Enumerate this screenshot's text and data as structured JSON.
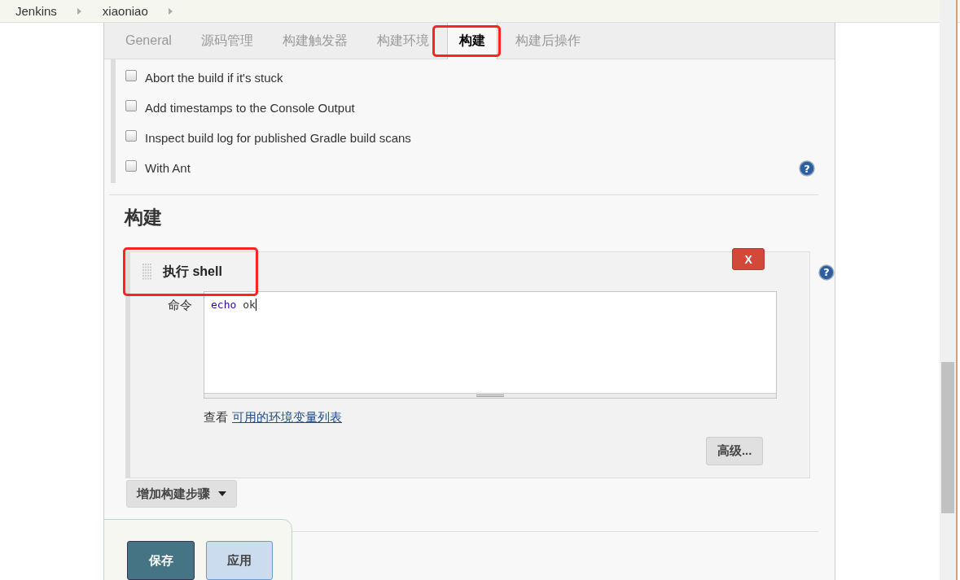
{
  "breadcrumbs": [
    {
      "label": "Jenkins"
    },
    {
      "label": "xiaoniao"
    }
  ],
  "tabs": [
    {
      "label": "General",
      "selected": false,
      "highlighted": false
    },
    {
      "label": "源码管理",
      "selected": false,
      "highlighted": false
    },
    {
      "label": "构建触发器",
      "selected": false,
      "highlighted": false
    },
    {
      "label": "构建环境",
      "selected": false,
      "highlighted": false
    },
    {
      "label": "构建",
      "selected": true,
      "highlighted": true
    },
    {
      "label": "构建后操作",
      "selected": false,
      "highlighted": false
    }
  ],
  "build_environment_options": [
    {
      "label": "Abort the build if it's stuck",
      "checked": false
    },
    {
      "label": "Add timestamps to the Console Output",
      "checked": false
    },
    {
      "label": "Inspect build log for published Gradle build scans",
      "checked": false
    },
    {
      "label": "With Ant",
      "checked": false
    }
  ],
  "build_environment_help": "?",
  "section_title": "构建",
  "build_step": {
    "title": "执行 shell",
    "highlighted": true,
    "delete_label": "X",
    "command_label": "命令",
    "command": [
      {
        "text": "echo",
        "kind": "keyword"
      },
      {
        "text": " ok",
        "kind": "plain"
      }
    ],
    "env_hint": "查看",
    "env_link": "可用的环境变量列表",
    "advanced_button": "高级...",
    "help": "?"
  },
  "add_step_button": "增加构建步骤",
  "footer": {
    "save_button": "保存",
    "apply_button": "应用"
  }
}
